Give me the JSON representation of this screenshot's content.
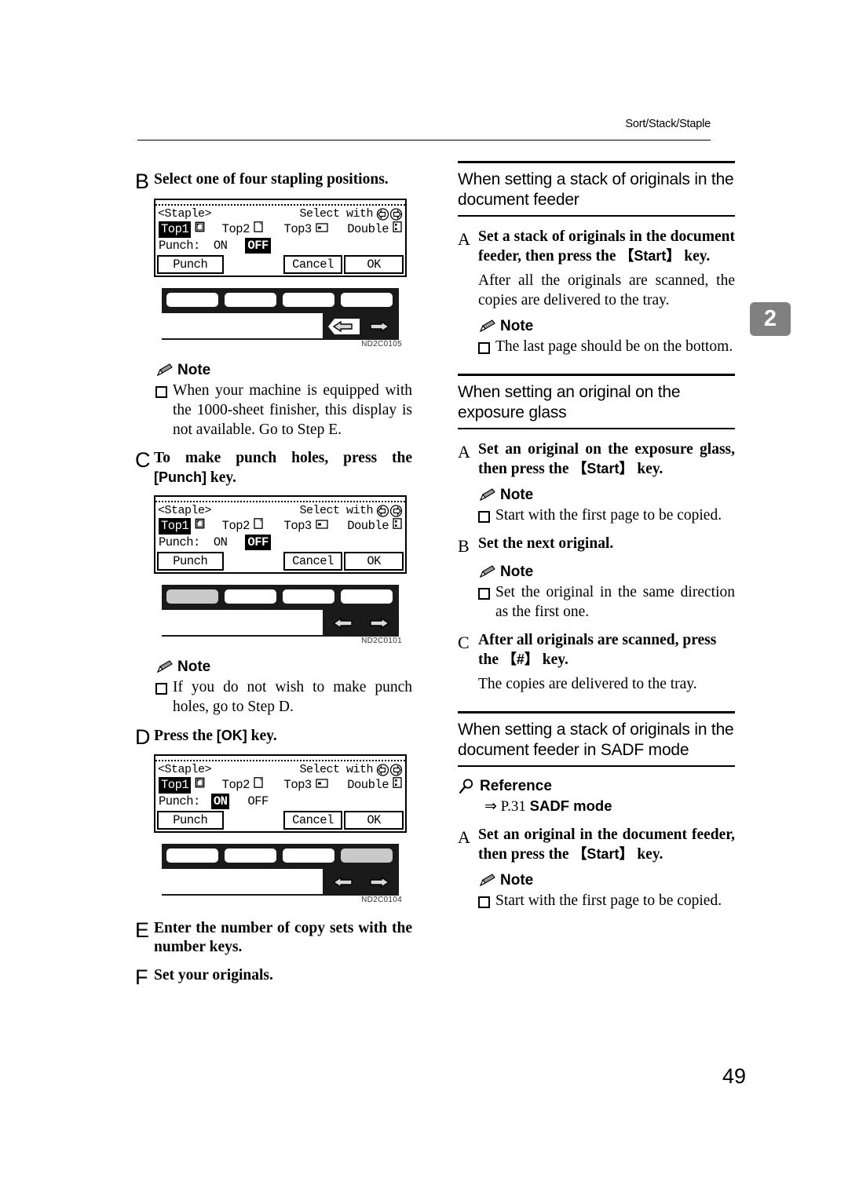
{
  "page": {
    "running_head": "Sort/Stack/Staple",
    "chapter_tab": "2",
    "page_number": "49"
  },
  "icons": {
    "note": "pencil-icon",
    "reference": "magnifier-icon",
    "bullet": "square-bullet-icon",
    "lcd_left_arrow": "lcd-left-arrow-icon",
    "lcd_right_arrow": "lcd-right-arrow-icon"
  },
  "left_column": {
    "step_b": {
      "letter": "B",
      "text": "Select one of four stapling positions."
    },
    "lcd_1": {
      "title": "<Staple>",
      "hint": "Select with",
      "positions": [
        {
          "label": "Top1",
          "selected": true
        },
        {
          "label": "Top2",
          "selected": false
        },
        {
          "label": "Top3",
          "selected": false
        },
        {
          "label": "Double",
          "selected": false
        }
      ],
      "punch_label": "Punch:",
      "punch_on": "ON",
      "punch_off": "OFF",
      "punch_selected": "OFF",
      "buttons": [
        "Punch",
        "Cancel",
        "OK"
      ]
    },
    "panel_1": {
      "code": "ND2C0105",
      "highlighted_key": -1,
      "key_count": 4
    },
    "note_1": {
      "heading": "Note",
      "items": [
        "When your machine is equipped with the 1000-sheet finisher, this display is not available. Go to Step E."
      ]
    },
    "step_c": {
      "letter": "C",
      "text_before": "To make punch holes, press the ",
      "key": "[Punch]",
      "text_after": " key."
    },
    "lcd_2": {
      "title": "<Staple>",
      "hint": "Select with",
      "positions": [
        {
          "label": "Top1",
          "selected": true
        },
        {
          "label": "Top2",
          "selected": false
        },
        {
          "label": "Top3",
          "selected": false
        },
        {
          "label": "Double",
          "selected": false
        }
      ],
      "punch_label": "Punch:",
      "punch_on": "ON",
      "punch_off": "OFF",
      "punch_selected": "OFF",
      "buttons": [
        "Punch",
        "Cancel",
        "OK"
      ]
    },
    "panel_2": {
      "code": "ND2C0101",
      "highlighted_key": 0,
      "key_count": 4
    },
    "note_2": {
      "heading": "Note",
      "items": [
        "If you do not wish to make punch holes, go to Step D."
      ]
    },
    "step_d": {
      "letter": "D",
      "text_before": "Press the ",
      "key": "[OK]",
      "text_after": " key."
    },
    "lcd_3": {
      "title": "<Staple>",
      "hint": "Select with",
      "positions": [
        {
          "label": "Top1",
          "selected": true
        },
        {
          "label": "Top2",
          "selected": false
        },
        {
          "label": "Top3",
          "selected": false
        },
        {
          "label": "Double",
          "selected": false
        }
      ],
      "punch_label": "Punch:",
      "punch_on": "ON",
      "punch_off": "OFF",
      "punch_selected": "ON",
      "buttons": [
        "Punch",
        "Cancel",
        "OK"
      ]
    },
    "panel_3": {
      "code": "ND2C0104",
      "highlighted_key": 3,
      "key_count": 4
    },
    "step_e": {
      "letter": "E",
      "text": "Enter the number of copy sets with the number keys."
    },
    "step_f": {
      "letter": "F",
      "text": "Set your originals."
    }
  },
  "right_column": {
    "section_1": {
      "title": "When setting a stack of originals in the document feeder",
      "step_a": {
        "letter": "A",
        "text_before": "Set a stack of originals in the document feeder, then press the ",
        "key": "【Start】",
        "text_after": " key."
      },
      "body": "After all the originals are scanned, the copies are delivered to the tray.",
      "note": {
        "heading": "Note",
        "items": [
          "The last page should be on the bottom."
        ]
      }
    },
    "section_2": {
      "title": "When setting an original on the exposure glass",
      "step_a": {
        "letter": "A",
        "text_before": "Set an original on the exposure glass, then press the ",
        "key": "【Start】",
        "text_after": " key."
      },
      "note_a": {
        "heading": "Note",
        "items": [
          "Start with the first page to be copied."
        ]
      },
      "step_b": {
        "letter": "B",
        "text": "Set the next original."
      },
      "note_b": {
        "heading": "Note",
        "items": [
          "Set the original in the same direction as the first one."
        ]
      },
      "step_c": {
        "letter": "C",
        "text_before": "After all originals are scanned, press the ",
        "key": "【#】",
        "text_after": " key."
      },
      "body": "The copies are delivered to the tray."
    },
    "section_3": {
      "title": "When setting a stack of originals in the document feeder in SADF mode",
      "reference": {
        "heading": "Reference",
        "arrow": "⇒",
        "page_ref": "P.31",
        "link_text": "SADF mode"
      },
      "step_a": {
        "letter": "A",
        "text_before": "Set an original in the document feeder, then press the ",
        "key": "【Start】",
        "text_after": " key."
      },
      "note": {
        "heading": "Note",
        "items": [
          "Start with the first page to be copied."
        ]
      }
    }
  }
}
